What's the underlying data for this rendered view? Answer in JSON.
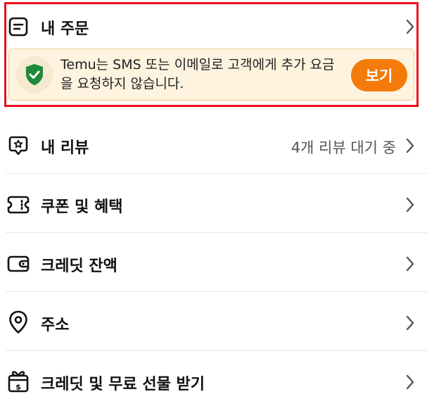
{
  "orders": {
    "label": "내 주문",
    "icon": "order-list-icon"
  },
  "notice": {
    "message": "Temu는 SMS 또는 이메일로 고객에게 추가 요금을 요청하지 않습니다.",
    "button_label": "보기",
    "icon": "shield-check-icon"
  },
  "menu": [
    {
      "label": "내 리뷰",
      "right_text": "4개 리뷰 대기 중",
      "icon": "review-star-icon"
    },
    {
      "label": "쿠폰 및 혜택",
      "right_text": "",
      "icon": "coupon-icon"
    },
    {
      "label": "크레딧 잔액",
      "right_text": "",
      "icon": "wallet-icon"
    },
    {
      "label": "주소",
      "right_text": "",
      "icon": "location-pin-icon"
    },
    {
      "label": "크레딧 및 무료 선물 받기",
      "right_text": "",
      "icon": "gift-icon"
    }
  ],
  "colors": {
    "highlight": "#e8101c",
    "accent": "#f47b0a",
    "notice_bg": "#fdf3df",
    "shield_green": "#1f8a3b"
  }
}
